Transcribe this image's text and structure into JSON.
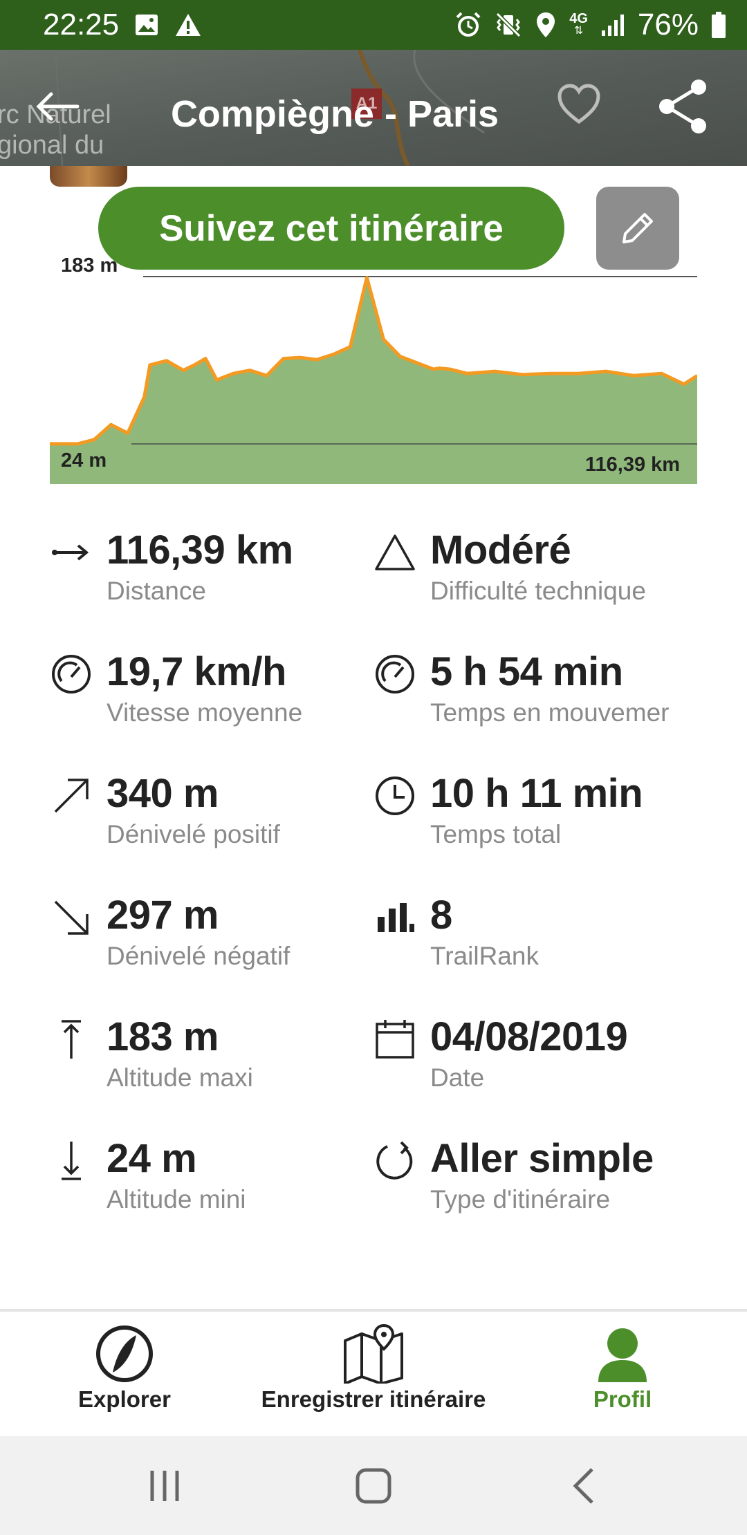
{
  "status_bar": {
    "time": "22:25",
    "left_icons": [
      "image-icon",
      "warning-icon"
    ],
    "right_icons": [
      "alarm-icon",
      "vibrate-icon",
      "location-icon",
      "network-4g-icon",
      "signal-icon",
      "battery-icon"
    ],
    "network": "4G",
    "battery": "76%"
  },
  "header": {
    "title": "Compiègne - Paris",
    "map_text": [
      "rc Naturel",
      "gional du"
    ],
    "map_sign": "A1"
  },
  "actions": {
    "follow_label": "Suivez cet itinéraire"
  },
  "elevation_profile": {
    "max_label": "183 m",
    "min_label": "24 m",
    "distance_label": "116,39 km"
  },
  "chart_data": {
    "type": "area",
    "xlim": [
      0,
      116.39
    ],
    "ylim": [
      24,
      183
    ],
    "x": [
      0,
      5,
      8,
      11,
      14,
      17,
      18,
      21,
      24,
      26,
      28,
      30,
      33,
      36,
      39,
      42,
      45,
      48,
      51,
      54,
      57,
      60,
      63,
      65,
      67,
      68,
      69,
      70,
      72,
      75,
      80,
      85,
      90,
      95,
      100,
      105,
      110,
      114,
      116.39
    ],
    "y": [
      26,
      26,
      30,
      44,
      36,
      70,
      100,
      104,
      95,
      100,
      106,
      86,
      92,
      95,
      90,
      106,
      107,
      105,
      110,
      117,
      182,
      124,
      108,
      104,
      100,
      98,
      96,
      97,
      96,
      92,
      94,
      91,
      92,
      92,
      94,
      90,
      92,
      82,
      90
    ]
  },
  "stats": [
    {
      "icon": "distance-arrow-icon",
      "value": "116,39 km",
      "label": "Distance"
    },
    {
      "icon": "triangle-icon",
      "value": "Modéré",
      "label": "Difficulté technique"
    },
    {
      "icon": "speedometer-icon",
      "value": "19,7 km/h",
      "label": "Vitesse moyenne"
    },
    {
      "icon": "speedometer-icon",
      "value": "5 h 54 min",
      "label": "Temps en mouvemer"
    },
    {
      "icon": "arrow-up-right-icon",
      "value": "340 m",
      "label": "Dénivelé positif"
    },
    {
      "icon": "clock-icon",
      "value": "10 h 11 min",
      "label": "Temps total"
    },
    {
      "icon": "arrow-down-right-icon",
      "value": "297 m",
      "label": "Dénivelé négatif"
    },
    {
      "icon": "bar-chart-icon",
      "value": "8",
      "label": "TrailRank"
    },
    {
      "icon": "arrow-up-bar-icon",
      "value": "183 m",
      "label": "Altitude maxi"
    },
    {
      "icon": "calendar-icon",
      "value": "04/08/2019",
      "label": "Date"
    },
    {
      "icon": "arrow-down-bar-icon",
      "value": "24 m",
      "label": "Altitude mini"
    },
    {
      "icon": "circular-arrow-icon",
      "value": "Aller simple",
      "label": "Type d'itinéraire"
    }
  ],
  "bottom_nav": {
    "explore": "Explorer",
    "record": "Enregistrer itinéraire",
    "profile": "Profil",
    "active_color": "#4b8e2a"
  },
  "colors": {
    "status_bar": "#2e5f1b",
    "primary_green": "#4b8e2a",
    "elevation_line": "#f39a23",
    "elevation_fill": "#8fb87a"
  }
}
